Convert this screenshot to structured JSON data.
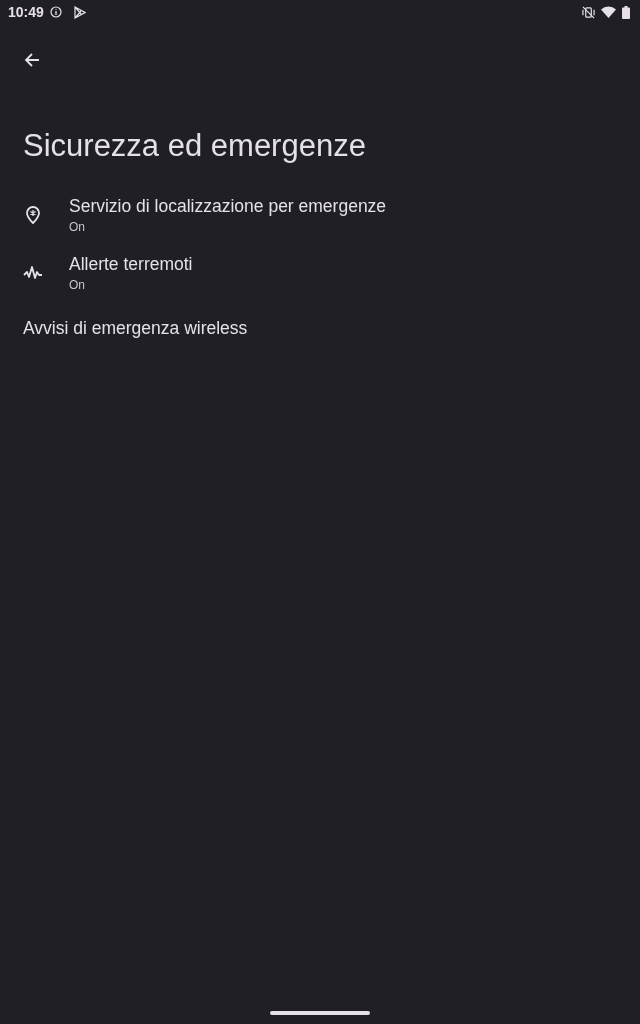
{
  "status_bar": {
    "time": "10:49"
  },
  "title": "Sicurezza ed emergenze",
  "items": [
    {
      "kind": "location",
      "title": "Servizio di localizzazione per emergenze",
      "summary": "On"
    },
    {
      "kind": "pulse",
      "title": "Allerte terremoti",
      "summary": "On"
    },
    {
      "kind": "plain",
      "title": "Avvisi di emergenza wireless"
    }
  ]
}
